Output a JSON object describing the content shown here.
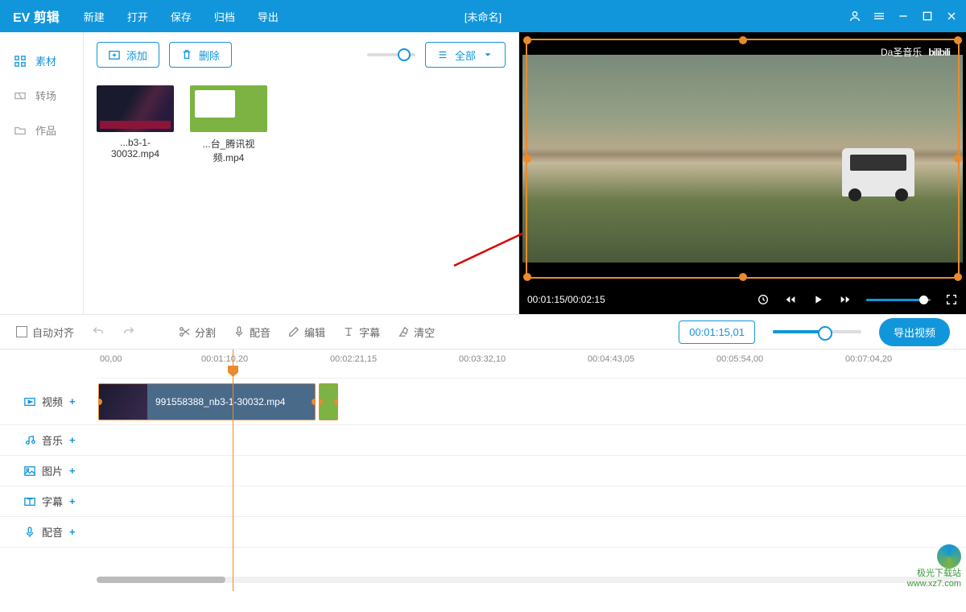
{
  "app_title": "EV 剪辑",
  "menu": {
    "new": "新建",
    "open": "打开",
    "save": "保存",
    "archive": "归档",
    "export": "导出"
  },
  "doc_title": "[未命名]",
  "sidebar": {
    "material": "素材",
    "transition": "转场",
    "works": "作品"
  },
  "material_toolbar": {
    "add": "添加",
    "delete": "删除",
    "filter": "全部"
  },
  "thumbs": [
    {
      "name": "...b3-1-30032.mp4"
    },
    {
      "name": "...台_腾讯视频.mp4"
    }
  ],
  "preview": {
    "time": "00:01:15/00:02:15",
    "watermark_user": "Da圣音乐",
    "watermark_site": "bilibili"
  },
  "toolbar": {
    "auto_align": "自动对齐",
    "split": "分割",
    "dub": "配音",
    "edit": "编辑",
    "subtitle": "字幕",
    "clear": "清空",
    "timecode": "00:01:15,01",
    "export_video": "导出视频"
  },
  "ruler": {
    "t0": "00,00",
    "t1": "00:01:10,20",
    "t2": "00:02:21,15",
    "t3": "00:03:32,10",
    "t4": "00:04:43,05",
    "t5": "00:05:54,00",
    "t6": "00:07:04,20"
  },
  "tracks": {
    "video": "视频",
    "audio": "音乐",
    "image": "图片",
    "subtitle": "字幕",
    "dub": "配音"
  },
  "clip_main": "991558388_nb3-1-30032.mp4",
  "corner_wm": {
    "line1": "极光下载站",
    "line2": "www.xz7.com"
  }
}
